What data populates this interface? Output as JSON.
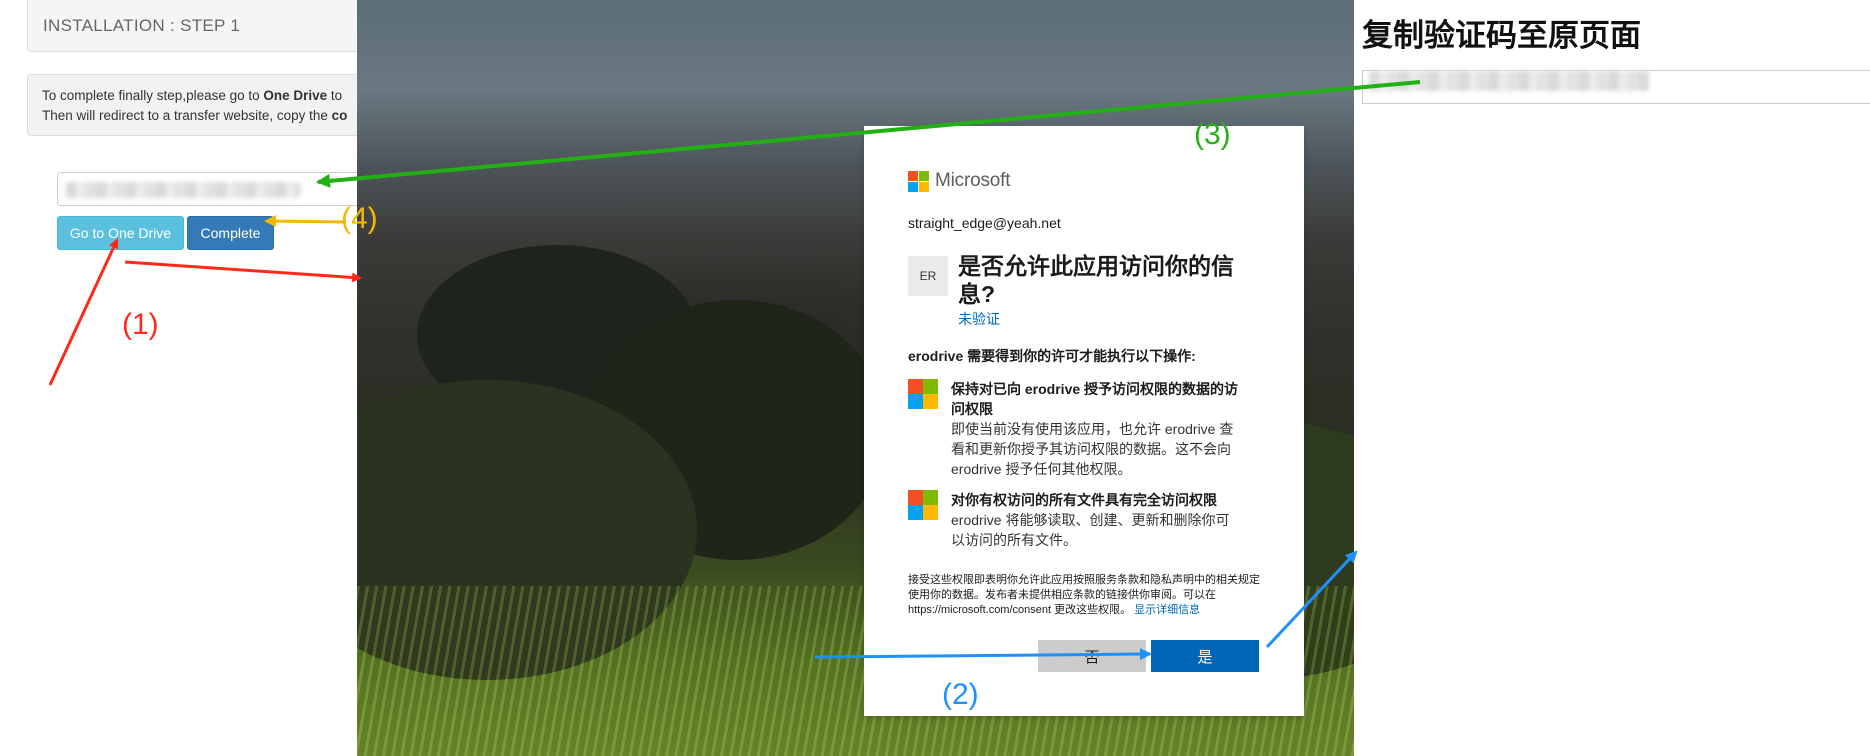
{
  "left_page": {
    "panel_title": "INSTALLATION : STEP 1",
    "instructions": {
      "line1_prefix": "To complete finally step,please go to ",
      "line1_bold": "One Drive",
      "line1_suffix": " to",
      "line2_prefix": "Then will redirect to a transfer website, copy the ",
      "line2_bold": "co"
    },
    "buttons": {
      "go": "Go to One Drive",
      "complete": "Complete"
    }
  },
  "consent": {
    "brand": "Microsoft",
    "email": "straight_edge@yeah.net",
    "app_initials": "ER",
    "title": "是否允许此应用访问你的信息?",
    "unverified": "未验证",
    "request": "erodrive 需要得到你的许可才能执行以下操作:",
    "permissions": [
      {
        "title": "保持对已向 erodrive 授予访问权限的数据的访问权限",
        "desc": "即使当前没有使用该应用，也允许 erodrive 查看和更新你授予其访问权限的数据。这不会向 erodrive 授予任何其他权限。"
      },
      {
        "title": "对你有权访问的所有文件具有完全访问权限",
        "desc": "erodrive 将能够读取、创建、更新和删除你可以访问的所有文件。"
      }
    ],
    "fine_print": "接受这些权限即表明你允许此应用按照服务条款和隐私声明中的相关规定使用你的数据。发布者未提供相应条款的链接供你审阅。可以在 https://microsoft.com/consent 更改这些权限。",
    "fine_link": "显示详细信息",
    "btn_no": "否",
    "btn_yes": "是",
    "ms_colors": [
      "#f25022",
      "#7fba00",
      "#00a4ef",
      "#ffb900"
    ]
  },
  "right_page": {
    "title": "复制验证码至原页面"
  },
  "annotations": {
    "step1": {
      "label": "(1)",
      "color": "#ff2a1a"
    },
    "step2": {
      "label": "(2)",
      "color": "#1e90ff"
    },
    "step3": {
      "label": "(3)",
      "color": "#22b014"
    },
    "step4": {
      "label": "(4)",
      "color": "#f5b800"
    }
  }
}
